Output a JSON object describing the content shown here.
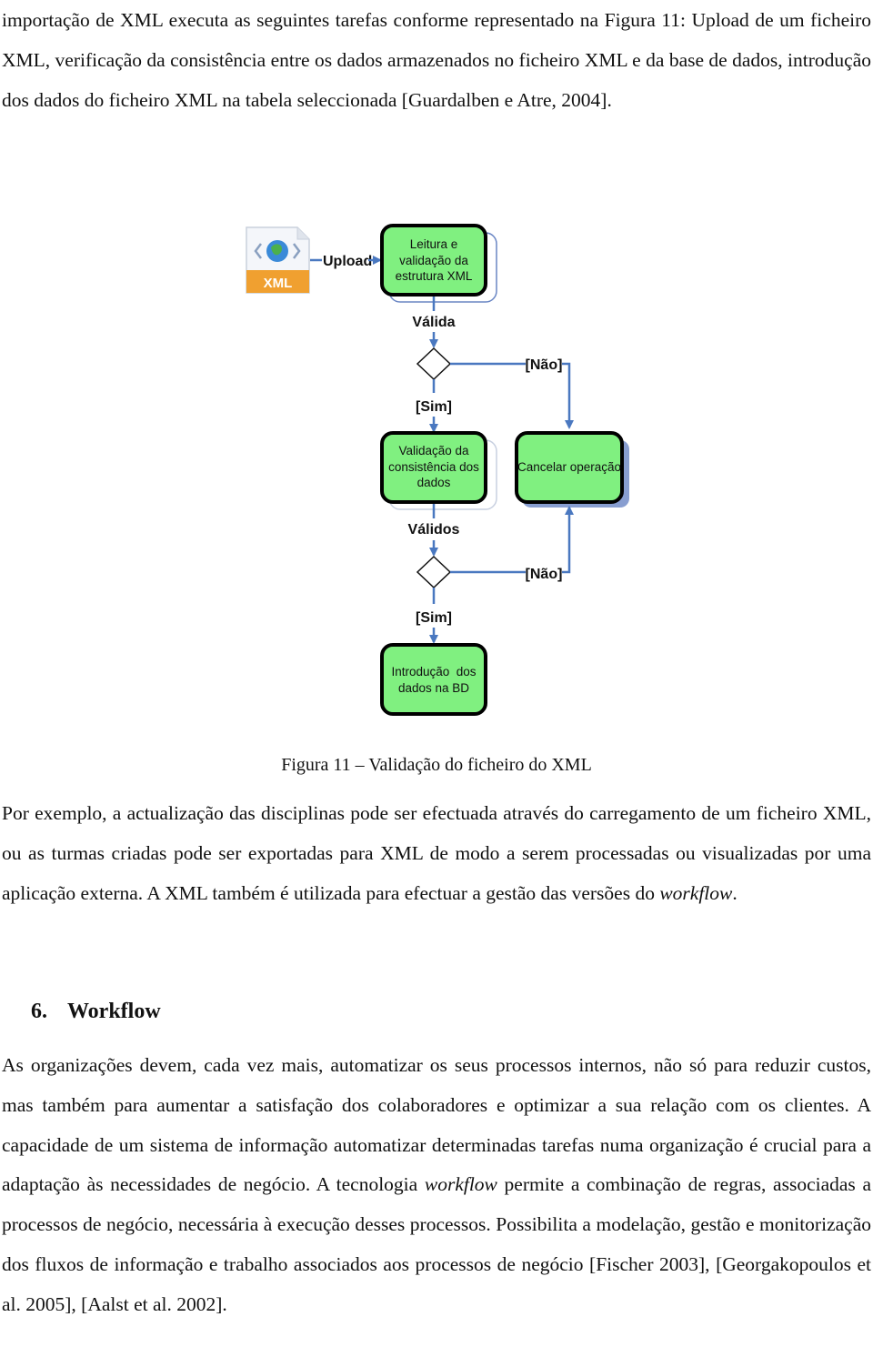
{
  "paragraph1": {
    "text": "importação de XML executa as seguintes tarefas conforme representado na Figura 11: Upload de um ficheiro XML, verificação da consistência entre os dados armazenados no ficheiro XML e da base de dados, introdução dos dados do ficheiro XML na tabela seleccionada [Guardalben e Atre, 2004]."
  },
  "diagram": {
    "xml_icon_label": "XML",
    "upload_label": "Upload",
    "box_read": [
      "Leitura e",
      "validação da",
      "estrutura XML"
    ],
    "valid_label": "Válida",
    "no_label_1": "[Não]",
    "yes_label_1": "[Sim]",
    "box_consistency": [
      "Validação da",
      "consistência dos",
      "dados"
    ],
    "box_cancel": "Cancelar operação",
    "valids_label": "Válidos",
    "no_label_2": "[Não]",
    "yes_label_2": "[Sim]",
    "box_insert": [
      "Introdução  dos",
      "dados na BD"
    ],
    "colors": {
      "box_fill": "#80f080",
      "box_border": "#000000",
      "arrow": "#4a78c0",
      "shadow": "#6a86c4",
      "xml_orange": "#f0a030"
    }
  },
  "caption": "Figura 11 – Validação do ficheiro do XML",
  "paragraph2": {
    "before_italic": "Por exemplo, a actualização das disciplinas pode ser efectuada através do carregamento de um ficheiro XML, ou as turmas criadas pode ser exportadas para XML de modo a serem processadas ou visualizadas por uma aplicação externa. A XML também é utilizada para efectuar a gestão das versões do ",
    "italic": "workflow",
    "after_italic": "."
  },
  "section": {
    "number": "6.",
    "title": "Workflow"
  },
  "paragraph3": {
    "part1": "As organizações devem, cada vez mais, automatizar os seus processos internos, não só para reduzir custos, mas também para aumentar a satisfação dos colaboradores e optimizar a sua relação com os clientes. A capacidade de um sistema de informação automatizar determinadas tarefas numa organização é crucial para a adaptação às necessidades de negócio. A tecnologia ",
    "italic": "workflow",
    "part2": " permite a combinação de regras, associadas a processos de negócio, necessária à execução desses processos. Possibilita a modelação, gestão e monitorização dos fluxos de informação e trabalho associados aos processos de negócio [Fischer 2003], [Georgakopoulos et al. 2005], [Aalst et al. 2002]."
  }
}
